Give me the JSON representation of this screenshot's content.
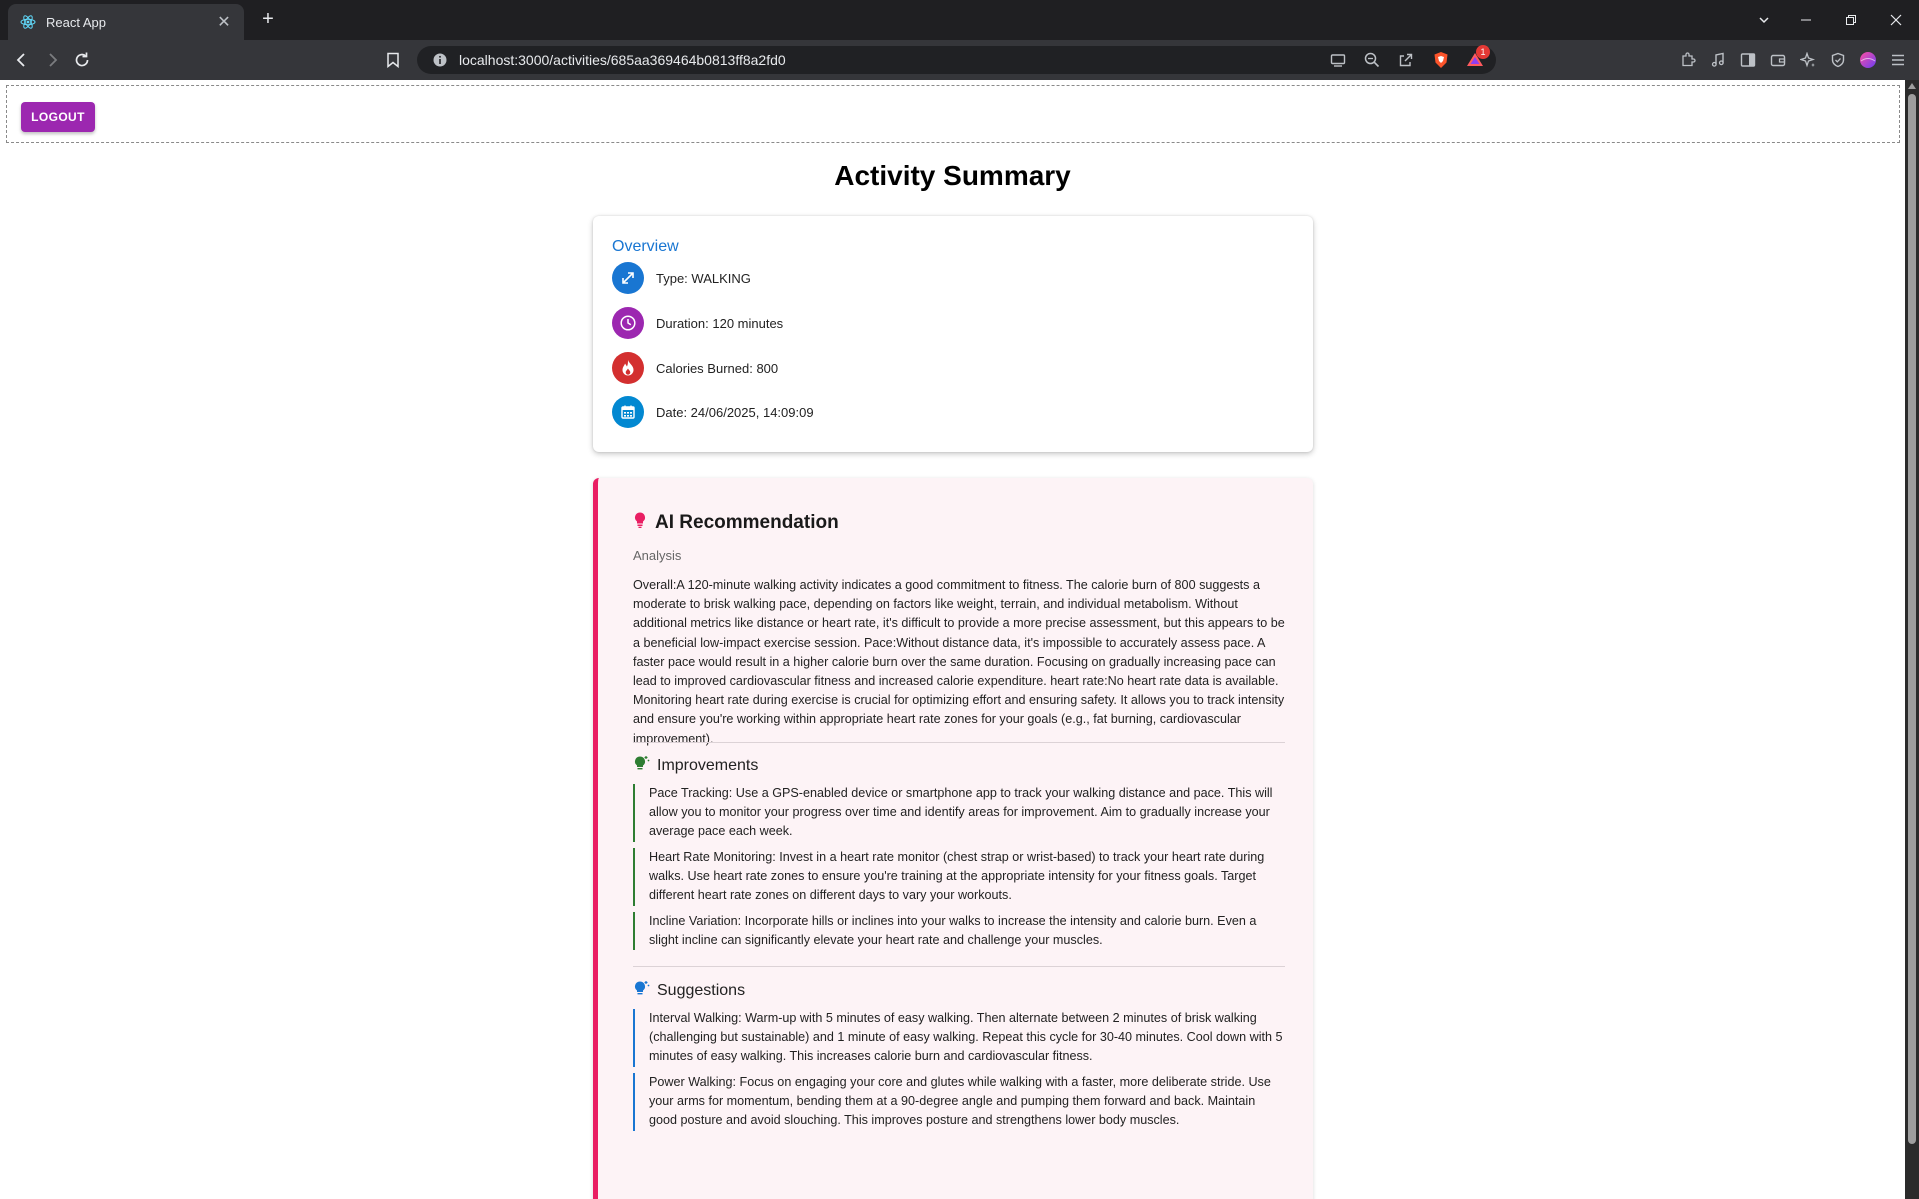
{
  "browser": {
    "tab_title": "React App",
    "url": "localhost:3000/activities/685aa369464b0813ff8a2fd0",
    "notification_count": "1"
  },
  "header": {
    "logout_label": "LOGOUT"
  },
  "page_title": "Activity Summary",
  "overview": {
    "heading": "Overview",
    "type": "Type: WALKING",
    "duration": "Duration: 120 minutes",
    "calories": "Calories Burned: 800",
    "date": "Date: 24/06/2025, 14:09:09"
  },
  "ai": {
    "heading": "AI Recommendation",
    "analysis_label": "Analysis",
    "analysis_text": "Overall:A 120-minute walking activity indicates a good commitment to fitness. The calorie burn of 800 suggests a moderate to brisk walking pace, depending on factors like weight, terrain, and individual metabolism. Without additional metrics like distance or heart rate, it's difficult to provide a more precise assessment, but this appears to be a beneficial low-impact exercise session. Pace:Without distance data, it's impossible to accurately assess pace. A faster pace would result in a higher calorie burn over the same duration. Focusing on gradually increasing pace can lead to improved cardiovascular fitness and increased calorie expenditure. heart rate:No heart rate data is available. Monitoring heart rate during exercise is crucial for optimizing effort and ensuring safety. It allows you to track intensity and ensure you're working within appropriate heart rate zones for your goals (e.g., fat burning, cardiovascular improvement).",
    "improvements_heading": "Improvements",
    "improvements": [
      "Pace Tracking: Use a GPS-enabled device or smartphone app to track your walking distance and pace. This will allow you to monitor your progress over time and identify areas for improvement. Aim to gradually increase your average pace each week.",
      "Heart Rate Monitoring: Invest in a heart rate monitor (chest strap or wrist-based) to track your heart rate during walks. Use heart rate zones to ensure you're training at the appropriate intensity for your fitness goals. Target different heart rate zones on different days to vary your workouts.",
      "Incline Variation: Incorporate hills or inclines into your walks to increase the intensity and calorie burn. Even a slight incline can significantly elevate your heart rate and challenge your muscles."
    ],
    "suggestions_heading": "Suggestions",
    "suggestions": [
      "Interval Walking: Warm-up with 5 minutes of easy walking. Then alternate between 2 minutes of brisk walking (challenging but sustainable) and 1 minute of easy walking. Repeat this cycle for 30-40 minutes. Cool down with 5 minutes of easy walking. This increases calorie burn and cardiovascular fitness.",
      "Power Walking: Focus on engaging your core and glutes while walking with a faster, more deliberate stride. Use your arms for momentum, bending them at a 90-degree angle and pumping them forward and back. Maintain good posture and avoid slouching. This improves posture and strengthens lower body muscles."
    ]
  },
  "colors": {
    "logout_bg": "#9c27b0",
    "overview_heading": "#1976d2",
    "type_icon_bg": "#1976d2",
    "duration_icon_bg": "#9c27b0",
    "calories_icon_bg": "#d32f2f",
    "date_icon_bg": "#0288d1",
    "ai_accent": "#e91e63",
    "improvements_accent": "#2e7d32",
    "suggestions_accent": "#1976d2"
  },
  "icons": {
    "type": "arrows-diagonal-icon",
    "duration": "clock-icon",
    "calories": "flame-icon",
    "date": "calendar-icon",
    "ai": "lightbulb-icon",
    "improvements": "lightbulb-sparkle-icon",
    "suggestions": "lightbulb-sparkle-icon"
  }
}
